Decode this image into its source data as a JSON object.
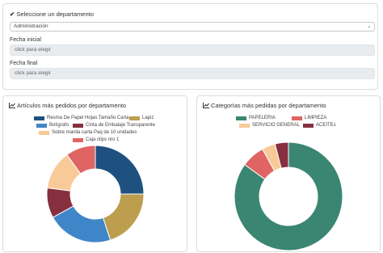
{
  "filter": {
    "title": "Seleccione un departamento",
    "department_value": "Administración",
    "fecha_inicial_label": "Fecha inicial",
    "fecha_inicial_placeholder": "click para elegir",
    "fecha_final_label": "Fecha final",
    "fecha_final_placeholder": "click para elegir"
  },
  "card_articulos": {
    "title": "Artículos más pedidos por departamento",
    "legend": [
      {
        "label": "Resma De Papel Hojas Tamaño Carta",
        "color": "#1e5180"
      },
      {
        "label": "Lapiz",
        "color": "#bd9e4f"
      },
      {
        "label": "Bolígrafo",
        "color": "#3f86c8"
      },
      {
        "label": "Cinta de Embalaje Transparente",
        "color": "#86303f"
      },
      {
        "label": "Sobre manila carta Paq de 10 unidades",
        "color": "#f7ca98"
      },
      {
        "label": "Caja clips nro 1",
        "color": "#e06464"
      }
    ]
  },
  "card_categorias": {
    "title": "Categorías más pedidas por departamento",
    "legend": [
      {
        "label": "PAPELERIA",
        "color": "#3a8672"
      },
      {
        "label": "LIMPIEZA",
        "color": "#e06464"
      },
      {
        "label": "SERVICIO GENERAL",
        "color": "#f7ca98"
      },
      {
        "label": "ACEITEs",
        "color": "#86303f"
      }
    ]
  },
  "chart_data": [
    {
      "type": "pie",
      "title": "Artículos más pedidos por departamento",
      "categories": [
        "Resma De Papel Hojas Tamaño Carta",
        "Lapiz",
        "Bolígrafo",
        "Cinta de Embalaje Transparente",
        "Sobre manila carta Paq de 10 unidades",
        "Caja clips nro 1"
      ],
      "values": [
        25,
        20,
        22,
        10,
        13,
        10
      ],
      "colors": [
        "#1e5180",
        "#bd9e4f",
        "#3f86c8",
        "#86303f",
        "#f7ca98",
        "#e06464"
      ],
      "legend": "top"
    },
    {
      "type": "pie",
      "title": "Categorías más pedidas por departamento",
      "categories": [
        "PAPELERIA",
        "LIMPIEZA",
        "SERVICIO GENERAL",
        "ACEITEs"
      ],
      "values": [
        85,
        7,
        4,
        4
      ],
      "colors": [
        "#3a8672",
        "#e06464",
        "#f7ca98",
        "#86303f"
      ],
      "legend": "top"
    }
  ]
}
